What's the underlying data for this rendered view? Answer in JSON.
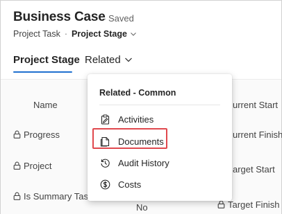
{
  "header": {
    "title": "Business Case",
    "status": "- Saved",
    "entity": "Project Task",
    "separator": "·",
    "form_name": "Project Stage"
  },
  "tabs": [
    {
      "label": "Project Stage",
      "selected": true
    },
    {
      "label": "Related",
      "selected": false
    }
  ],
  "form": {
    "left_labels": [
      "Name",
      "Progress",
      "Project",
      "Is Summary Task"
    ],
    "left_locked": [
      false,
      true,
      true,
      true
    ],
    "right_labels": [
      "Current Start",
      "Current Finish",
      "Target Start",
      "Target Finish"
    ],
    "right_visible": [
      "urrent Start",
      "urrent Finish",
      "arget Start",
      "Target Finish"
    ],
    "value_fragment": "No"
  },
  "related_menu": {
    "header": "Related - Common",
    "items": [
      {
        "label": "Activities",
        "icon": "clipboard-icon"
      },
      {
        "label": "Documents",
        "icon": "document-icon",
        "highlighted": true
      },
      {
        "label": "Audit History",
        "icon": "history-icon"
      },
      {
        "label": "Costs",
        "icon": "dollar-icon"
      }
    ]
  },
  "colors": {
    "accent": "#1e6fcf",
    "highlight": "#e0484d",
    "text": "#242424"
  }
}
